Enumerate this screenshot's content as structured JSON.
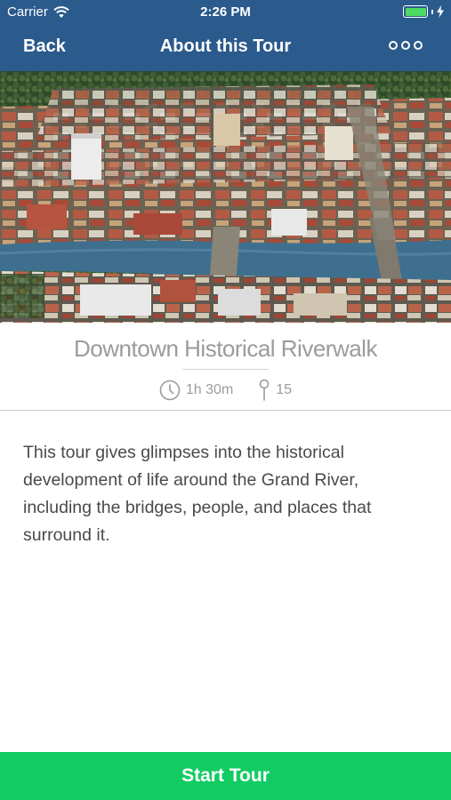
{
  "status_bar": {
    "carrier": "Carrier",
    "time": "2:26 PM",
    "battery_percent": 100,
    "battery_color": "#4cd964"
  },
  "nav": {
    "back_label": "Back",
    "title": "About this Tour",
    "more_icon": "more-dots-icon",
    "background": "#2b5a8c"
  },
  "hero": {
    "icon": "aerial-city-river-illustration"
  },
  "tour": {
    "title": "Downtown Historical Riverwalk",
    "duration": "1h 30m",
    "stops": "15",
    "duration_icon": "clock-icon",
    "stops_icon": "pin-icon"
  },
  "description": "This tour gives glimpses into the historical development of life around the Grand River, including the bridges, people, and places that surround it.",
  "footer": {
    "start_label": "Start Tour",
    "color": "#12cc63"
  }
}
